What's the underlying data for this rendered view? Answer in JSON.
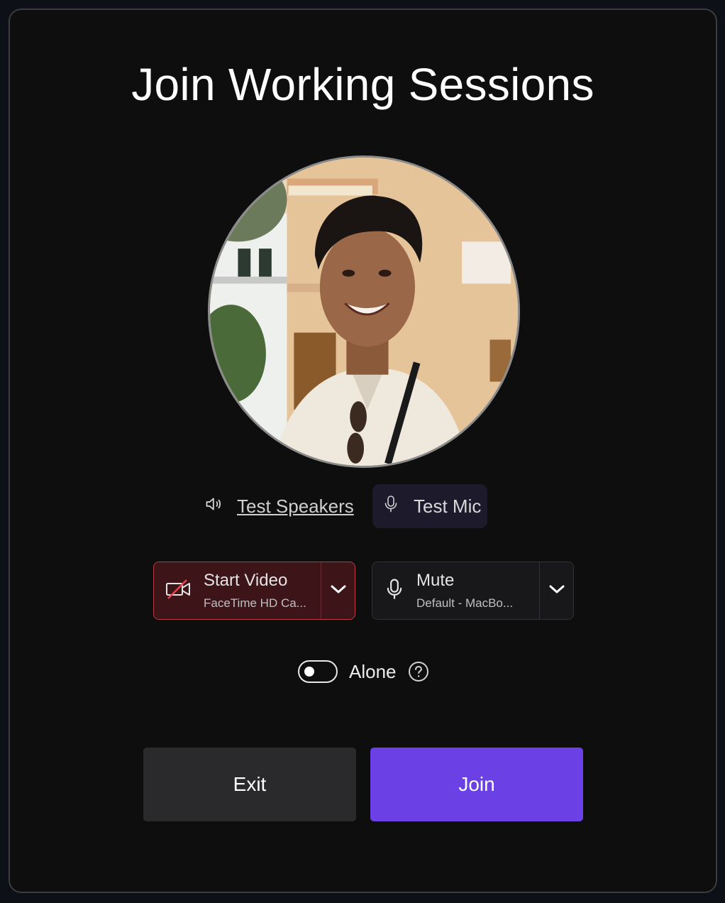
{
  "dialog": {
    "title": "Join Working Sessions"
  },
  "tests": {
    "speakers_label": "Test Speakers",
    "speakers_icon": "speaker-icon",
    "mic_label": "Test Mic",
    "mic_icon": "microphone-icon"
  },
  "video": {
    "title": "Start Video",
    "device": "FaceTime HD Ca...",
    "icon": "video-off-icon",
    "state": "off",
    "accent": "#b83a45"
  },
  "audio": {
    "title": "Mute",
    "device": "Default - MacBo...",
    "icon": "microphone-icon"
  },
  "alone": {
    "label": "Alone",
    "enabled": false,
    "help_icon": "question-circle-icon"
  },
  "actions": {
    "exit_label": "Exit",
    "join_label": "Join",
    "join_color": "#6b40e4"
  }
}
